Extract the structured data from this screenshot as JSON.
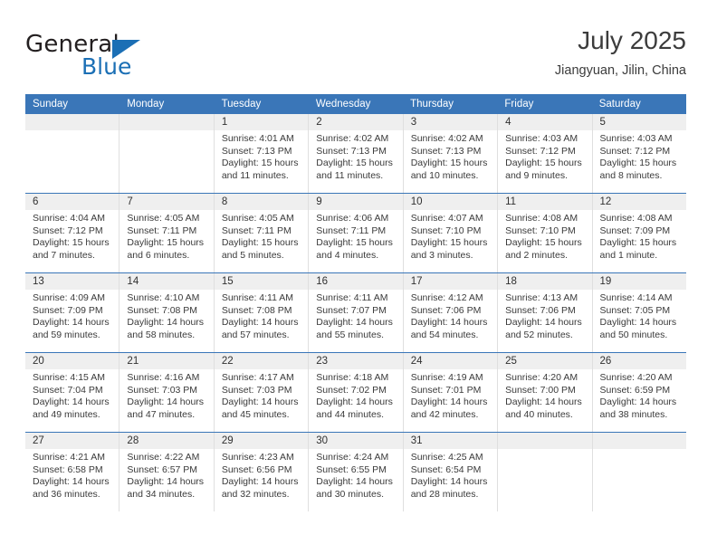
{
  "brand": {
    "word_general": "General",
    "word_blue": "Blue",
    "triangle_color": "#1b6fb5",
    "text_color": "#231f20"
  },
  "header": {
    "title": "July 2025",
    "subtitle": "Jiangyuan, Jilin, China"
  },
  "theme": {
    "header_blue": "#3a76b8",
    "date_band_grey": "#efefef",
    "divider_grey": "#dfdfdf",
    "body_text": "#3a3a3a"
  },
  "weekday_headers": [
    "Sunday",
    "Monday",
    "Tuesday",
    "Wednesday",
    "Thursday",
    "Friday",
    "Saturday"
  ],
  "weeks": [
    {
      "dates": [
        "",
        "",
        "1",
        "2",
        "3",
        "4",
        "5"
      ],
      "cells": [
        {
          "empty": true,
          "lines": [
            "",
            "",
            "",
            ""
          ]
        },
        {
          "empty": true,
          "lines": [
            "",
            "",
            "",
            ""
          ]
        },
        {
          "empty": false,
          "lines": [
            "Sunrise: 4:01 AM",
            "Sunset: 7:13 PM",
            "Daylight: 15 hours",
            "and 11 minutes."
          ]
        },
        {
          "empty": false,
          "lines": [
            "Sunrise: 4:02 AM",
            "Sunset: 7:13 PM",
            "Daylight: 15 hours",
            "and 11 minutes."
          ]
        },
        {
          "empty": false,
          "lines": [
            "Sunrise: 4:02 AM",
            "Sunset: 7:13 PM",
            "Daylight: 15 hours",
            "and 10 minutes."
          ]
        },
        {
          "empty": false,
          "lines": [
            "Sunrise: 4:03 AM",
            "Sunset: 7:12 PM",
            "Daylight: 15 hours",
            "and 9 minutes."
          ]
        },
        {
          "empty": false,
          "lines": [
            "Sunrise: 4:03 AM",
            "Sunset: 7:12 PM",
            "Daylight: 15 hours",
            "and 8 minutes."
          ]
        }
      ]
    },
    {
      "dates": [
        "6",
        "7",
        "8",
        "9",
        "10",
        "11",
        "12"
      ],
      "cells": [
        {
          "empty": false,
          "lines": [
            "Sunrise: 4:04 AM",
            "Sunset: 7:12 PM",
            "Daylight: 15 hours",
            "and 7 minutes."
          ]
        },
        {
          "empty": false,
          "lines": [
            "Sunrise: 4:05 AM",
            "Sunset: 7:11 PM",
            "Daylight: 15 hours",
            "and 6 minutes."
          ]
        },
        {
          "empty": false,
          "lines": [
            "Sunrise: 4:05 AM",
            "Sunset: 7:11 PM",
            "Daylight: 15 hours",
            "and 5 minutes."
          ]
        },
        {
          "empty": false,
          "lines": [
            "Sunrise: 4:06 AM",
            "Sunset: 7:11 PM",
            "Daylight: 15 hours",
            "and 4 minutes."
          ]
        },
        {
          "empty": false,
          "lines": [
            "Sunrise: 4:07 AM",
            "Sunset: 7:10 PM",
            "Daylight: 15 hours",
            "and 3 minutes."
          ]
        },
        {
          "empty": false,
          "lines": [
            "Sunrise: 4:08 AM",
            "Sunset: 7:10 PM",
            "Daylight: 15 hours",
            "and 2 minutes."
          ]
        },
        {
          "empty": false,
          "lines": [
            "Sunrise: 4:08 AM",
            "Sunset: 7:09 PM",
            "Daylight: 15 hours",
            "and 1 minute."
          ]
        }
      ]
    },
    {
      "dates": [
        "13",
        "14",
        "15",
        "16",
        "17",
        "18",
        "19"
      ],
      "cells": [
        {
          "empty": false,
          "lines": [
            "Sunrise: 4:09 AM",
            "Sunset: 7:09 PM",
            "Daylight: 14 hours",
            "and 59 minutes."
          ]
        },
        {
          "empty": false,
          "lines": [
            "Sunrise: 4:10 AM",
            "Sunset: 7:08 PM",
            "Daylight: 14 hours",
            "and 58 minutes."
          ]
        },
        {
          "empty": false,
          "lines": [
            "Sunrise: 4:11 AM",
            "Sunset: 7:08 PM",
            "Daylight: 14 hours",
            "and 57 minutes."
          ]
        },
        {
          "empty": false,
          "lines": [
            "Sunrise: 4:11 AM",
            "Sunset: 7:07 PM",
            "Daylight: 14 hours",
            "and 55 minutes."
          ]
        },
        {
          "empty": false,
          "lines": [
            "Sunrise: 4:12 AM",
            "Sunset: 7:06 PM",
            "Daylight: 14 hours",
            "and 54 minutes."
          ]
        },
        {
          "empty": false,
          "lines": [
            "Sunrise: 4:13 AM",
            "Sunset: 7:06 PM",
            "Daylight: 14 hours",
            "and 52 minutes."
          ]
        },
        {
          "empty": false,
          "lines": [
            "Sunrise: 4:14 AM",
            "Sunset: 7:05 PM",
            "Daylight: 14 hours",
            "and 50 minutes."
          ]
        }
      ]
    },
    {
      "dates": [
        "20",
        "21",
        "22",
        "23",
        "24",
        "25",
        "26"
      ],
      "cells": [
        {
          "empty": false,
          "lines": [
            "Sunrise: 4:15 AM",
            "Sunset: 7:04 PM",
            "Daylight: 14 hours",
            "and 49 minutes."
          ]
        },
        {
          "empty": false,
          "lines": [
            "Sunrise: 4:16 AM",
            "Sunset: 7:03 PM",
            "Daylight: 14 hours",
            "and 47 minutes."
          ]
        },
        {
          "empty": false,
          "lines": [
            "Sunrise: 4:17 AM",
            "Sunset: 7:03 PM",
            "Daylight: 14 hours",
            "and 45 minutes."
          ]
        },
        {
          "empty": false,
          "lines": [
            "Sunrise: 4:18 AM",
            "Sunset: 7:02 PM",
            "Daylight: 14 hours",
            "and 44 minutes."
          ]
        },
        {
          "empty": false,
          "lines": [
            "Sunrise: 4:19 AM",
            "Sunset: 7:01 PM",
            "Daylight: 14 hours",
            "and 42 minutes."
          ]
        },
        {
          "empty": false,
          "lines": [
            "Sunrise: 4:20 AM",
            "Sunset: 7:00 PM",
            "Daylight: 14 hours",
            "and 40 minutes."
          ]
        },
        {
          "empty": false,
          "lines": [
            "Sunrise: 4:20 AM",
            "Sunset: 6:59 PM",
            "Daylight: 14 hours",
            "and 38 minutes."
          ]
        }
      ]
    },
    {
      "dates": [
        "27",
        "28",
        "29",
        "30",
        "31",
        "",
        ""
      ],
      "cells": [
        {
          "empty": false,
          "lines": [
            "Sunrise: 4:21 AM",
            "Sunset: 6:58 PM",
            "Daylight: 14 hours",
            "and 36 minutes."
          ]
        },
        {
          "empty": false,
          "lines": [
            "Sunrise: 4:22 AM",
            "Sunset: 6:57 PM",
            "Daylight: 14 hours",
            "and 34 minutes."
          ]
        },
        {
          "empty": false,
          "lines": [
            "Sunrise: 4:23 AM",
            "Sunset: 6:56 PM",
            "Daylight: 14 hours",
            "and 32 minutes."
          ]
        },
        {
          "empty": false,
          "lines": [
            "Sunrise: 4:24 AM",
            "Sunset: 6:55 PM",
            "Daylight: 14 hours",
            "and 30 minutes."
          ]
        },
        {
          "empty": false,
          "lines": [
            "Sunrise: 4:25 AM",
            "Sunset: 6:54 PM",
            "Daylight: 14 hours",
            "and 28 minutes."
          ]
        },
        {
          "empty": true,
          "lines": [
            "",
            "",
            "",
            ""
          ]
        },
        {
          "empty": true,
          "lines": [
            "",
            "",
            "",
            ""
          ]
        }
      ]
    }
  ]
}
